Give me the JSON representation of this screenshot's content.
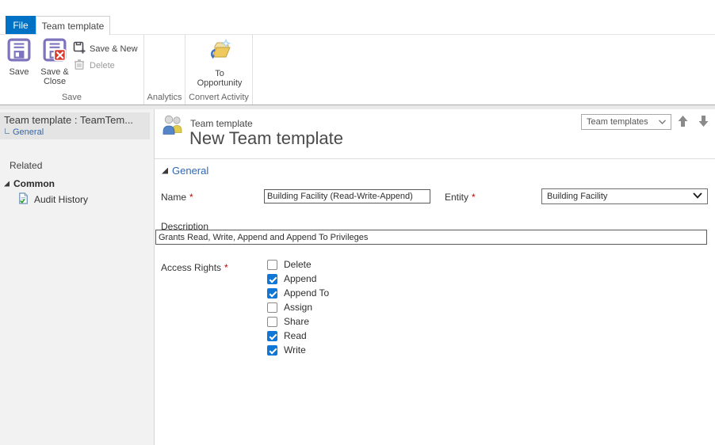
{
  "tabs": {
    "file": "File",
    "team_template": "Team template"
  },
  "ribbon": {
    "save_group": {
      "label": "Save",
      "save": "Save",
      "save_close_1": "Save &",
      "save_close_2": "Close",
      "save_new": "Save & New",
      "delete": "Delete"
    },
    "analytics_group": {
      "label": "Analytics"
    },
    "convert_group": {
      "label": "Convert Activity",
      "to_opportunity_1": "To",
      "to_opportunity_2": "Opportunity"
    }
  },
  "sidebar": {
    "title": "Team template : TeamTem...",
    "subnav": "General",
    "related": "Related",
    "common": "Common",
    "audit_history": "Audit History"
  },
  "header": {
    "entity_type": "Team template",
    "title": "New Team template",
    "view_selector": "Team templates"
  },
  "form": {
    "section": "General",
    "required_marker": "*",
    "name_label": "Name",
    "name_value": "Building Facility (Read-Write-Append)",
    "entity_label": "Entity",
    "entity_value": "Building Facility",
    "description_label": "Description",
    "description_value": "Grants Read, Write, Append and Append To Privileges",
    "access_rights_label": "Access Rights",
    "access_rights": [
      {
        "label": "Delete",
        "checked": false
      },
      {
        "label": "Append",
        "checked": true
      },
      {
        "label": "Append To",
        "checked": true
      },
      {
        "label": "Assign",
        "checked": false
      },
      {
        "label": "Share",
        "checked": false
      },
      {
        "label": "Read",
        "checked": true
      },
      {
        "label": "Write",
        "checked": true
      }
    ]
  },
  "colors": {
    "accent_blue": "#0072C6",
    "link_blue": "#2F67B2",
    "checkbox_blue": "#1177D7",
    "required_red": "#C00000"
  }
}
